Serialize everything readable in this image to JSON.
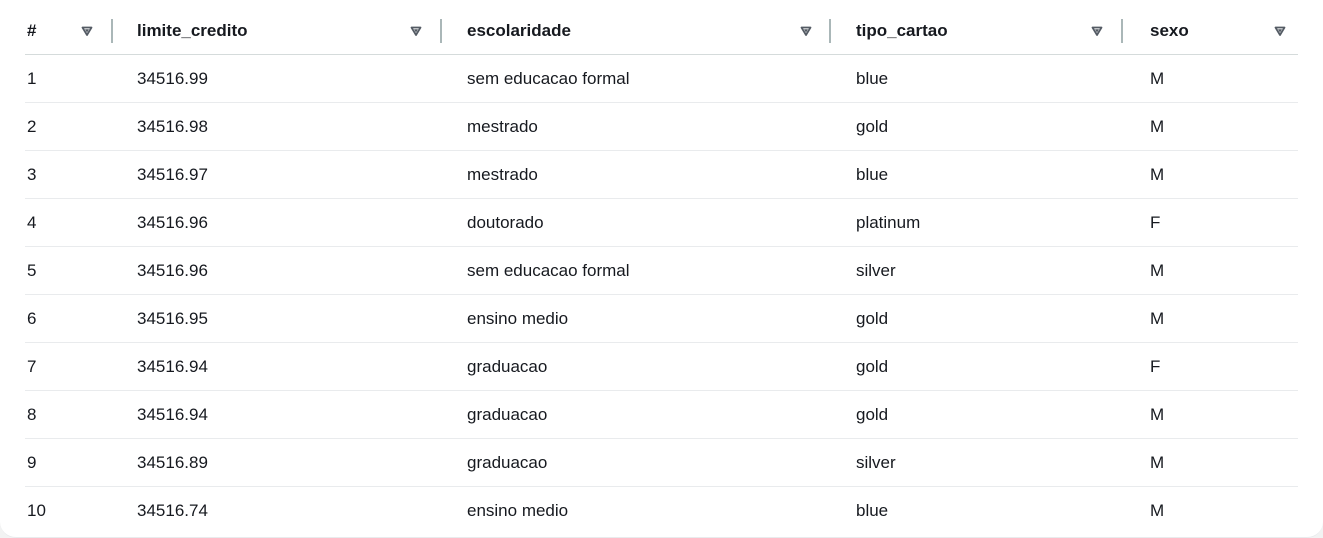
{
  "table": {
    "columns": [
      {
        "key": "index",
        "label": "#",
        "sort_icon": "filled-down-triangle-icon"
      },
      {
        "key": "limite_credito",
        "label": "limite_credito",
        "sort_icon": "filled-down-triangle-icon"
      },
      {
        "key": "escolaridade",
        "label": "escolaridade",
        "sort_icon": "filled-down-triangle-icon"
      },
      {
        "key": "tipo_cartao",
        "label": "tipo_cartao",
        "sort_icon": "filled-down-triangle-icon"
      },
      {
        "key": "sexo",
        "label": "sexo",
        "sort_icon": "filled-down-triangle-icon"
      }
    ],
    "rows": [
      {
        "index": "1",
        "limite_credito": "34516.99",
        "escolaridade": "sem educacao formal",
        "tipo_cartao": "blue",
        "sexo": "M"
      },
      {
        "index": "2",
        "limite_credito": "34516.98",
        "escolaridade": "mestrado",
        "tipo_cartao": "gold",
        "sexo": "M"
      },
      {
        "index": "3",
        "limite_credito": "34516.97",
        "escolaridade": "mestrado",
        "tipo_cartao": "blue",
        "sexo": "M"
      },
      {
        "index": "4",
        "limite_credito": "34516.96",
        "escolaridade": "doutorado",
        "tipo_cartao": "platinum",
        "sexo": "F"
      },
      {
        "index": "5",
        "limite_credito": "34516.96",
        "escolaridade": "sem educacao formal",
        "tipo_cartao": "silver",
        "sexo": "M"
      },
      {
        "index": "6",
        "limite_credito": "34516.95",
        "escolaridade": "ensino medio",
        "tipo_cartao": "gold",
        "sexo": "M"
      },
      {
        "index": "7",
        "limite_credito": "34516.94",
        "escolaridade": "graduacao",
        "tipo_cartao": "gold",
        "sexo": "F"
      },
      {
        "index": "8",
        "limite_credito": "34516.94",
        "escolaridade": "graduacao",
        "tipo_cartao": "gold",
        "sexo": "M"
      },
      {
        "index": "9",
        "limite_credito": "34516.89",
        "escolaridade": "graduacao",
        "tipo_cartao": "silver",
        "sexo": "M"
      },
      {
        "index": "10",
        "limite_credito": "34516.74",
        "escolaridade": "ensino medio",
        "tipo_cartao": "blue",
        "sexo": "M"
      }
    ]
  },
  "colors": {
    "text": "#16191f",
    "icon": "#545b64",
    "divider": "#aab7b8",
    "row_border": "#e9ebed"
  }
}
